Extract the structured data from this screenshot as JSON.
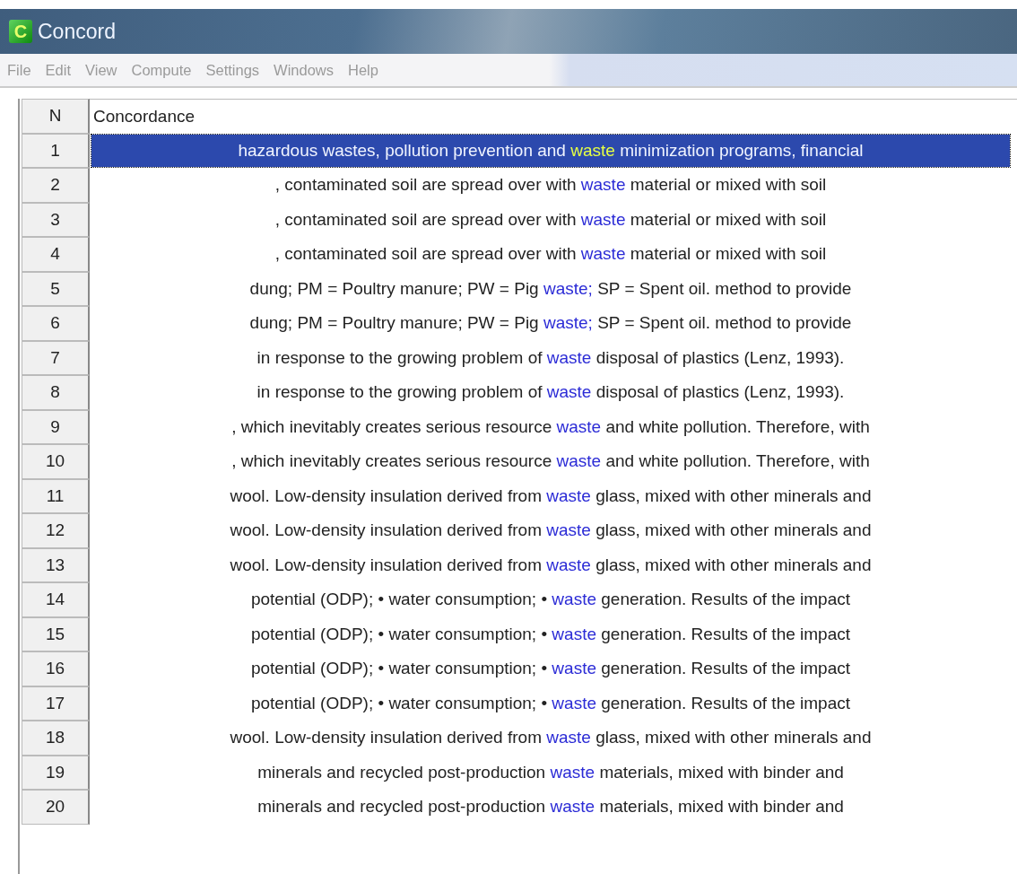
{
  "window": {
    "title": "Concord",
    "icon_letter": "C"
  },
  "menu": [
    "File",
    "Edit",
    "View",
    "Compute",
    "Settings",
    "Windows",
    "Help"
  ],
  "table": {
    "columns": [
      "N",
      "Concordance"
    ],
    "rows": [
      {
        "n": "1",
        "left": "hazardous wastes, pollution prevention and",
        "keyword": "waste",
        "right": " minimization programs, financial",
        "selected": true
      },
      {
        "n": "2",
        "left": ", contaminated soil are spread over with",
        "keyword": "waste",
        "right": " material or mixed with soil",
        "selected": false
      },
      {
        "n": "3",
        "left": ", contaminated soil are spread over with",
        "keyword": "waste",
        "right": " material or mixed with soil",
        "selected": false
      },
      {
        "n": "4",
        "left": ", contaminated soil are spread over with",
        "keyword": "waste",
        "right": " material or mixed with soil",
        "selected": false
      },
      {
        "n": "5",
        "left": "dung; PM = Poultry manure; PW = Pig",
        "keyword": "waste;",
        "right": " SP = Spent oil. method to provide",
        "selected": false
      },
      {
        "n": "6",
        "left": "dung; PM = Poultry manure; PW = Pig",
        "keyword": "waste;",
        "right": " SP = Spent oil. method to provide",
        "selected": false
      },
      {
        "n": "7",
        "left": "in response to the growing problem of",
        "keyword": "waste",
        "right": " disposal of plastics (Lenz, 1993).",
        "selected": false
      },
      {
        "n": "8",
        "left": "in response to the growing problem of",
        "keyword": "waste",
        "right": " disposal of plastics (Lenz, 1993).",
        "selected": false
      },
      {
        "n": "9",
        "left": ", which inevitably creates serious resource",
        "keyword": "waste",
        "right": " and white pollution. Therefore, with",
        "selected": false
      },
      {
        "n": "10",
        "left": ", which inevitably creates serious resource",
        "keyword": "waste",
        "right": " and white pollution. Therefore, with",
        "selected": false
      },
      {
        "n": "11",
        "left": "wool. Low-density insulation derived from",
        "keyword": "waste",
        "right": " glass, mixed with other minerals and",
        "selected": false
      },
      {
        "n": "12",
        "left": "wool. Low-density insulation derived from",
        "keyword": "waste",
        "right": " glass, mixed with other minerals and",
        "selected": false
      },
      {
        "n": "13",
        "left": "wool. Low-density insulation derived from",
        "keyword": "waste",
        "right": " glass, mixed with other minerals and",
        "selected": false
      },
      {
        "n": "14",
        "left": "potential (ODP); • water consumption; •",
        "keyword": "waste",
        "right": " generation. Results of the impact",
        "selected": false
      },
      {
        "n": "15",
        "left": "potential (ODP); • water consumption; •",
        "keyword": "waste",
        "right": " generation. Results of the impact",
        "selected": false
      },
      {
        "n": "16",
        "left": "potential (ODP); • water consumption; •",
        "keyword": "waste",
        "right": " generation. Results of the impact",
        "selected": false
      },
      {
        "n": "17",
        "left": "potential (ODP); • water consumption; •",
        "keyword": "waste",
        "right": " generation. Results of the impact",
        "selected": false
      },
      {
        "n": "18",
        "left": "wool. Low-density insulation derived from",
        "keyword": "waste",
        "right": " glass, mixed with other minerals and",
        "selected": false
      },
      {
        "n": "19",
        "left": "minerals and recycled post-production",
        "keyword": "waste",
        "right": " materials, mixed with binder and",
        "selected": false
      },
      {
        "n": "20",
        "left": "minerals and recycled post-production",
        "keyword": "waste",
        "right": " materials, mixed with binder and",
        "selected": false
      }
    ]
  }
}
